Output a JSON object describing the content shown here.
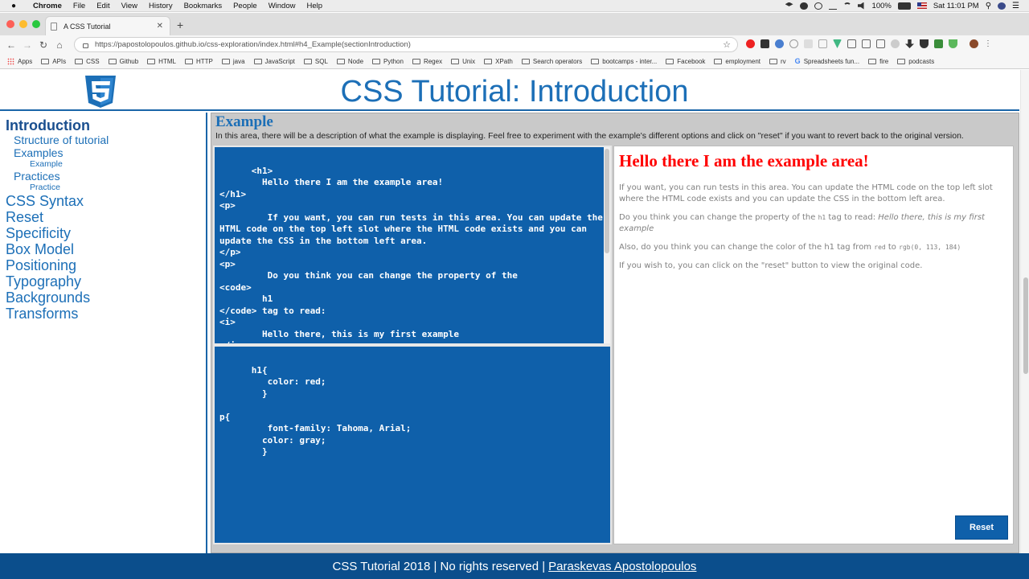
{
  "menubar": {
    "app": "Chrome",
    "items": [
      "File",
      "Edit",
      "View",
      "History",
      "Bookmarks",
      "People",
      "Window",
      "Help"
    ],
    "battery": "100%",
    "clock": "Sat 11:01 PM"
  },
  "browser": {
    "tab_title": "A CSS Tutorial",
    "url": "https://papostolopoulos.github.io/css-exploration/index.html#h4_Example(sectionIntroduction)",
    "bookmarks": [
      "Apps",
      "APIs",
      "CSS",
      "Github",
      "HTML",
      "HTTP",
      "java",
      "JavaScript",
      "SQL",
      "Node",
      "Python",
      "Regex",
      "Unix",
      "XPath",
      "Search operators",
      "bootcamps - inter...",
      "Facebook",
      "employment",
      "rv",
      "Spreadsheets fun...",
      "fire",
      "podcasts"
    ]
  },
  "page": {
    "title": "CSS Tutorial: Introduction",
    "sidebar": {
      "introduction": "Introduction",
      "structure": "Structure of tutorial",
      "examples": "Examples",
      "example": "Example",
      "practices": "Practices",
      "practice": "Practice",
      "css_syntax": "CSS Syntax",
      "reset": "Reset",
      "specificity": "Specificity",
      "box_model": "Box Model",
      "positioning": "Positioning",
      "typography": "Typography",
      "backgrounds": "Backgrounds",
      "transforms": "Transforms"
    },
    "example": {
      "heading": "Example",
      "description": "In this area, there will be a description of what the example is displaying. Feel free to experiment with the example's different options and click on \"reset\" if you want to revert back to the original version.",
      "html_code": "<h1>\n        Hello there I am the example area!\n</h1>\n<p>\n         If you want, you can run tests in this area. You can update the\nHTML code on the top left slot where the HTML code exists and you can\nupdate the CSS in the bottom left area.\n</p>\n<p>\n         Do you think you can change the property of the\n<code>\n        h1\n</code> tag to read:\n<i>\n        Hello there, this is my first example\n</i>",
      "css_code": "h1{\n         color: red;\n        }\n\np{\n         font-family: Tahoma, Arial;\n        color: gray;\n        }",
      "preview_h1": "Hello there I am the example area!",
      "preview_p1": "If you want, you can run tests in this area. You can update the HTML code on the top left slot where the HTML code exists and you can update the CSS in the bottom left area.",
      "preview_p2_a": "Do you think you can change the property of the",
      "preview_p2_code": "h1",
      "preview_p2_b": "tag to read:",
      "preview_p2_i": "Hello there, this is my first example",
      "preview_p3_a": "Also, do you think you can change the color of the h1 tag from",
      "preview_p3_code1": "red",
      "preview_p3_to": "to",
      "preview_p3_code2": "rgb(0, 113, 184)",
      "preview_p4": "If you wish to, you can click on the \"reset\" button to view the original code.",
      "reset_label": "Reset"
    },
    "footer": {
      "text": "CSS Tutorial 2018 | No rights reserved |",
      "author": "Paraskevas Apostolopoulos"
    }
  },
  "colors": {
    "brand_blue": "#1c6fb7",
    "editor_bg": "#0f60aa",
    "footer_bg": "#0b4e8c",
    "preview_h1": "#ff0000"
  }
}
